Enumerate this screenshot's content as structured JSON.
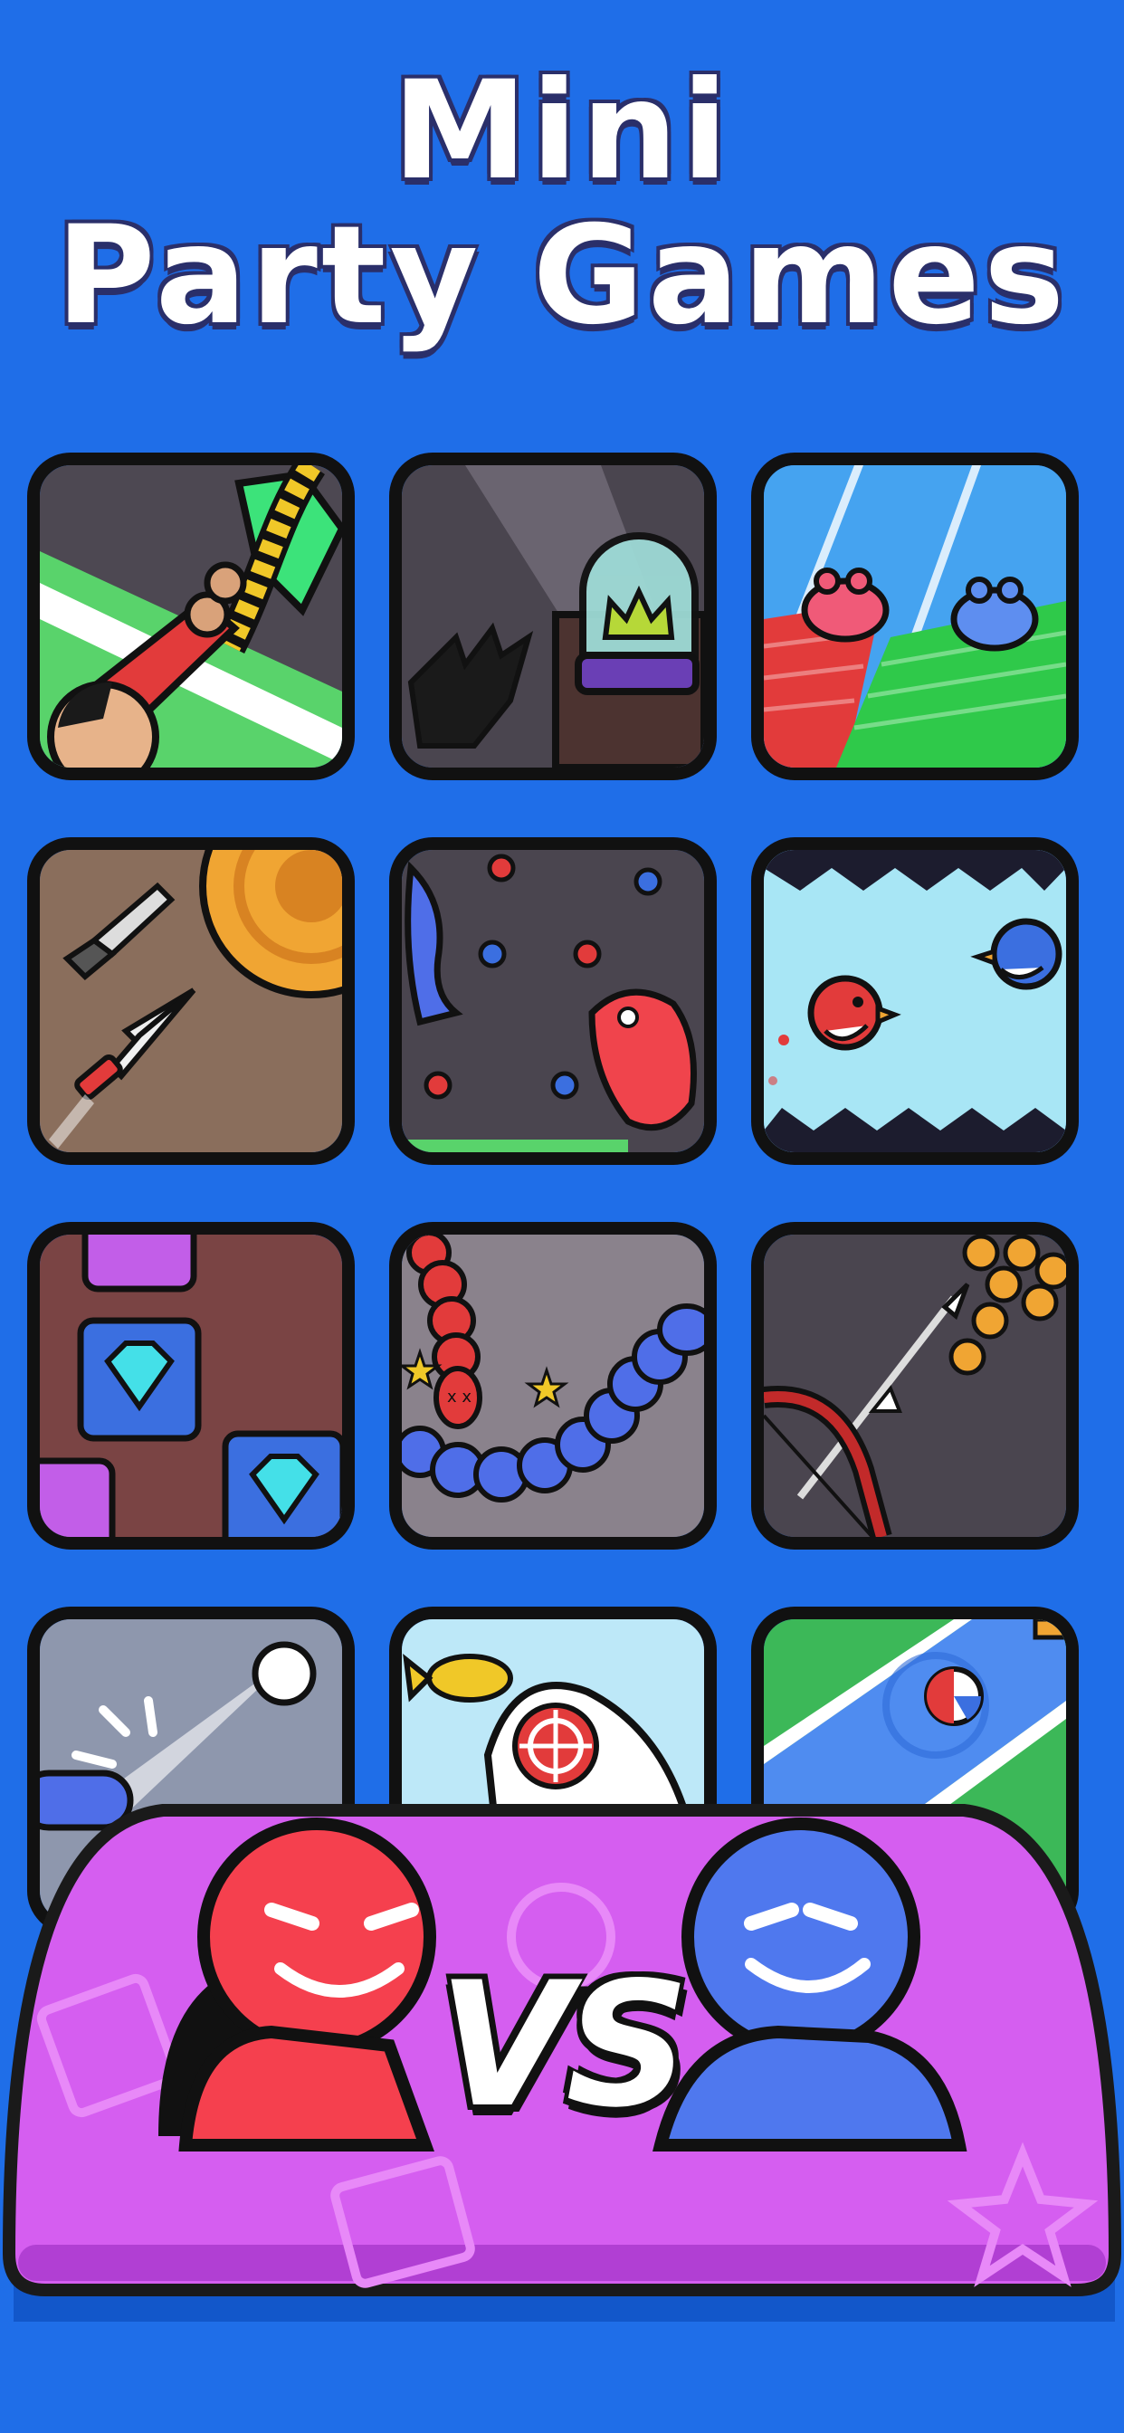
{
  "header": {
    "line1": "Mini",
    "line2": "Party Games"
  },
  "tiles": [
    {
      "id": "rope-climb",
      "icon": "rope-climber-icon"
    },
    {
      "id": "crown-steal",
      "icon": "crown-dome-icon"
    },
    {
      "id": "frog-stairs",
      "icon": "frogs-racing-icon"
    },
    {
      "id": "knife-throw",
      "icon": "knife-log-icon"
    },
    {
      "id": "dino-eat",
      "icon": "dinosaurs-balls-icon"
    },
    {
      "id": "bird-flap",
      "icon": "flappy-birds-icon"
    },
    {
      "id": "gem-match",
      "icon": "diamond-cards-icon"
    },
    {
      "id": "snake-battle",
      "icon": "snakes-icon"
    },
    {
      "id": "archery",
      "icon": "bow-arrow-icon"
    },
    {
      "id": "ball-bat",
      "icon": "ball-paddle-icon"
    },
    {
      "id": "seal-fish",
      "icon": "seal-target-icon"
    },
    {
      "id": "beach-ball",
      "icon": "beach-ball-icon"
    }
  ],
  "vs_banner": {
    "text": "VS",
    "player1_color": "#f5404e",
    "player2_color": "#4f78ee"
  },
  "colors": {
    "background": "#1f6ee8",
    "bench": "#d55ef0",
    "outline": "#111111"
  }
}
